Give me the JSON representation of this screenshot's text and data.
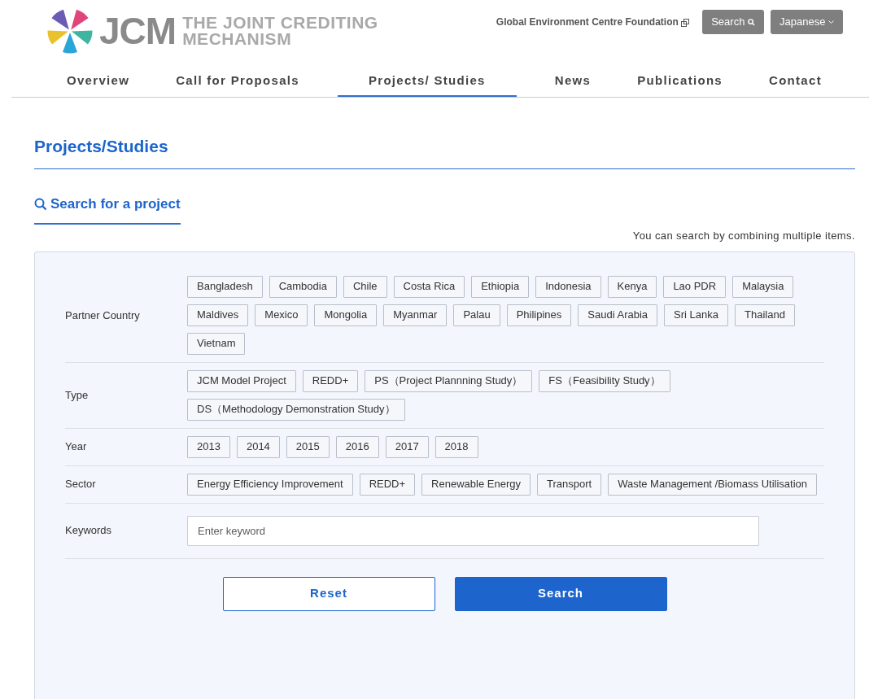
{
  "header": {
    "logo_mark": "JCM",
    "logo_text_lines": [
      "THE JOINT CREDITING",
      "MECHANISM"
    ],
    "org_link": "Global Environment Centre Foundation",
    "search_button": "Search",
    "language_button": "Japanese"
  },
  "nav": [
    {
      "label": "Overview",
      "selected": false
    },
    {
      "label": "Call for Proposals",
      "selected": false
    },
    {
      "label": "Projects/ Studies",
      "selected": true
    },
    {
      "label": "News",
      "selected": false
    },
    {
      "label": "Publications",
      "selected": false
    },
    {
      "label": "Contact",
      "selected": false
    }
  ],
  "page_title": "Projects/Studies",
  "section_title": "Search for a project",
  "hint": "You can search by combining multiple items.",
  "filters": [
    {
      "label": "Partner Country",
      "kind": "tags",
      "options": [
        "Bangladesh",
        "Cambodia",
        "Chile",
        "Costa Rica",
        "Ethiopia",
        "Indonesia",
        "Kenya",
        "Lao PDR",
        "Malaysia",
        "Maldives",
        "Mexico",
        "Mongolia",
        "Myanmar",
        "Palau",
        "Philipines",
        "Saudi Arabia",
        "Sri Lanka",
        "Thailand",
        "Vietnam"
      ]
    },
    {
      "label": "Type",
      "kind": "tags",
      "options": [
        "JCM Model Project",
        "REDD+",
        "PS（Project Plannning Study）",
        "FS（Feasibility Study）",
        "DS（Methodology Demonstration Study）"
      ]
    },
    {
      "label": "Year",
      "kind": "tags",
      "options": [
        "2013",
        "2014",
        "2015",
        "2016",
        "2017",
        "2018"
      ]
    },
    {
      "label": "Sector",
      "kind": "tags",
      "options": [
        "Energy Efficiency Improvement",
        "REDD+",
        "Renewable Energy",
        "Transport",
        "Waste Management /Biomass Utilisation"
      ]
    },
    {
      "label": "Keywords",
      "kind": "text",
      "placeholder": "Enter keyword"
    }
  ],
  "buttons": [
    {
      "label": "Reset",
      "kind": "secondary"
    },
    {
      "label": "Search",
      "kind": "primary"
    }
  ]
}
